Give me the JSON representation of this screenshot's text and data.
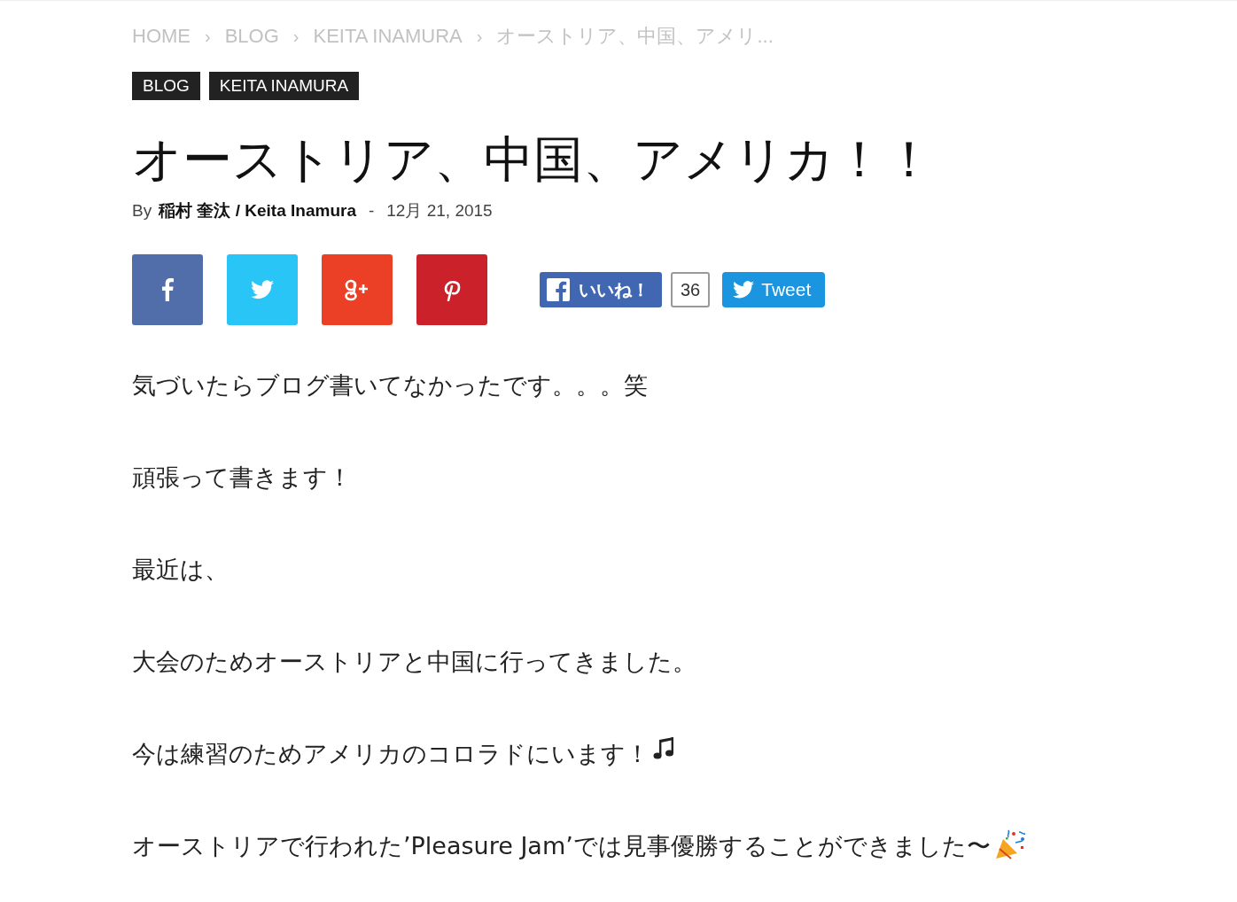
{
  "breadcrumbs": [
    {
      "label": "HOME",
      "separator": "›"
    },
    {
      "label": "BLOG",
      "separator": "›"
    },
    {
      "label": "KEITA INAMURA",
      "separator": "›"
    },
    {
      "label": "オーストリア、中国、アメリ..."
    }
  ],
  "categories": [
    "BLOG",
    "KEITA INAMURA"
  ],
  "title": "オーストリア、中国、アメリカ！！",
  "meta": {
    "by": "By",
    "author": "稲村 奎汰 / Keita Inamura",
    "separator": "-",
    "date": "12月 21, 2015"
  },
  "share_buttons": [
    {
      "kind": "facebook",
      "color": "#516eab"
    },
    {
      "kind": "twitter",
      "color": "#29c5f6"
    },
    {
      "kind": "googleplus",
      "color": "#eb4026"
    },
    {
      "kind": "pinterest",
      "color": "#ca212a"
    }
  ],
  "like_button": {
    "label": "いいね！",
    "count": "36"
  },
  "tweet_button": {
    "label": "Tweet"
  },
  "paragraphs": [
    {
      "text": "気づいたらブログ書いてなかったです。。。笑",
      "kind": "plain"
    },
    {
      "text": "頑張って書きます！",
      "kind": "plain"
    },
    {
      "text": "最近は、",
      "kind": "plain"
    },
    {
      "text": "大会のためオーストリアと中国に行ってきました。",
      "kind": "plain"
    },
    {
      "text": "今は練習のためアメリカのコロラドにいます！",
      "kind": "music"
    },
    {
      "text": "オーストリアで行われた’Pleasure Jam’では見事優勝することができました〜",
      "kind": "party"
    }
  ]
}
